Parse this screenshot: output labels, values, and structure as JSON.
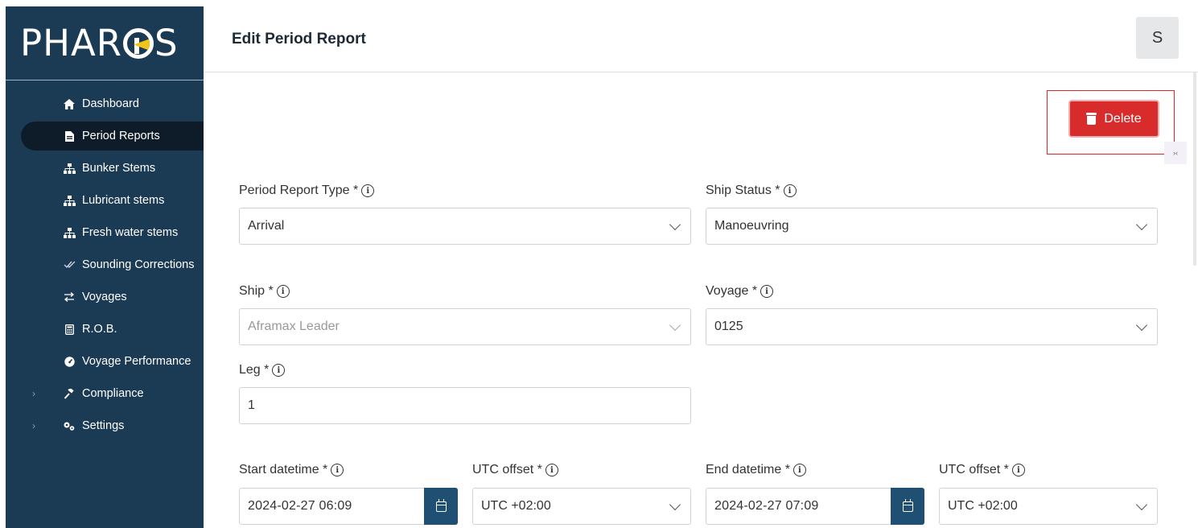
{
  "app": {
    "logo_text_left": "PHAR",
    "logo_text_right": "S"
  },
  "sidebar": {
    "items": [
      {
        "label": "Dashboard",
        "icon": "home-icon",
        "active": false
      },
      {
        "label": "Period Reports",
        "icon": "document-icon",
        "active": true
      },
      {
        "label": "Bunker Stems",
        "icon": "sitemap-icon",
        "active": false
      },
      {
        "label": "Lubricant stems",
        "icon": "sitemap-icon",
        "active": false
      },
      {
        "label": "Fresh water stems",
        "icon": "sitemap-icon",
        "active": false
      },
      {
        "label": "Sounding Corrections",
        "icon": "double-check-icon",
        "active": false
      },
      {
        "label": "Voyages",
        "icon": "swap-arrows-icon",
        "active": false
      },
      {
        "label": "R.O.B.",
        "icon": "calculator-icon",
        "active": false
      },
      {
        "label": "Voyage Performance",
        "icon": "gauge-icon",
        "active": false
      },
      {
        "label": "Compliance",
        "icon": "gavel-icon",
        "active": false,
        "expandable": true
      },
      {
        "label": "Settings",
        "icon": "gears-icon",
        "active": false,
        "expandable": true
      }
    ]
  },
  "header": {
    "title": "Edit Period Report",
    "avatar_initial": "S"
  },
  "actions": {
    "delete_label": "Delete"
  },
  "form": {
    "period_report_type": {
      "label": "Period Report Type *",
      "value": "Arrival"
    },
    "ship_status": {
      "label": "Ship Status *",
      "value": "Manoeuvring"
    },
    "ship": {
      "label": "Ship *",
      "value": "Aframax Leader"
    },
    "voyage": {
      "label": "Voyage *",
      "value": "0125"
    },
    "leg": {
      "label": "Leg *",
      "value": "1"
    },
    "start_datetime": {
      "label": "Start datetime *",
      "value": "2024-02-27 06:09"
    },
    "start_utc_offset": {
      "label": "UTC offset *",
      "value": "UTC +02:00"
    },
    "end_datetime": {
      "label": "End datetime *",
      "value": "2024-02-27 07:09"
    },
    "end_utc_offset": {
      "label": "UTC offset *",
      "value": "UTC +02:00"
    }
  },
  "colors": {
    "sidebar_bg": "#1b3a54",
    "active_item_bg": "#0d1c28",
    "danger": "#d82c2c",
    "primary": "#1f4f73"
  }
}
